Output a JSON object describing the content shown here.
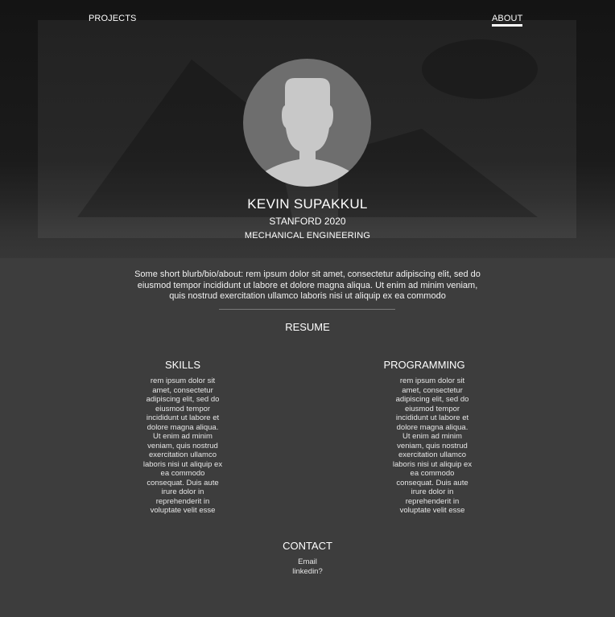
{
  "nav": {
    "projects_label": "PROJECTS",
    "about_label": "ABOUT"
  },
  "profile": {
    "name": "KEVIN SUPAKKUL",
    "school": "STANFORD 2020",
    "major": "MECHANICAL ENGINEERING",
    "bio": "Some short blurb/bio/about: rem ipsum dolor sit amet, consectetur adipiscing elit, sed do eiusmod tempor incididunt ut labore et dolore magna aliqua. Ut enim ad minim veniam, quis nostrud exercitation ullamco laboris nisi ut aliquip ex ea commodo"
  },
  "resume": {
    "title": "RESUME",
    "skills_title": "SKILLS",
    "skills_text": "rem ipsum dolor sit amet, consectetur adipiscing elit, sed do eiusmod tempor incididunt ut labore et dolore magna aliqua. Ut enim ad minim veniam, quis nostrud exercitation ullamco laboris nisi ut aliquip ex ea commodo consequat. Duis aute irure dolor in reprehenderit in voluptate velit esse",
    "programming_title": "PROGRAMMING",
    "programming_text": "rem ipsum dolor sit amet, consectetur adipiscing elit, sed do eiusmod tempor incididunt ut labore et dolore magna aliqua. Ut enim ad minim veniam, quis nostrud exercitation ullamco laboris nisi ut aliquip ex ea commodo consequat. Duis aute irure dolor in reprehenderit in voluptate velit esse"
  },
  "contact": {
    "title": "CONTACT",
    "email_label": "Email",
    "linkedin_label": "linkedin?"
  },
  "icons": {
    "hero": "image-placeholder-icon",
    "avatar": "user-avatar-icon"
  },
  "colors": {
    "page_background": "#3d3d3d",
    "hero_top": "#141414",
    "text": "#ffffff",
    "placeholder_fill": "#2a2a2a",
    "avatar_circle": "#6e6e6e",
    "avatar_silhouette": "#c8c8c8",
    "divider": "#7a7a7a"
  }
}
